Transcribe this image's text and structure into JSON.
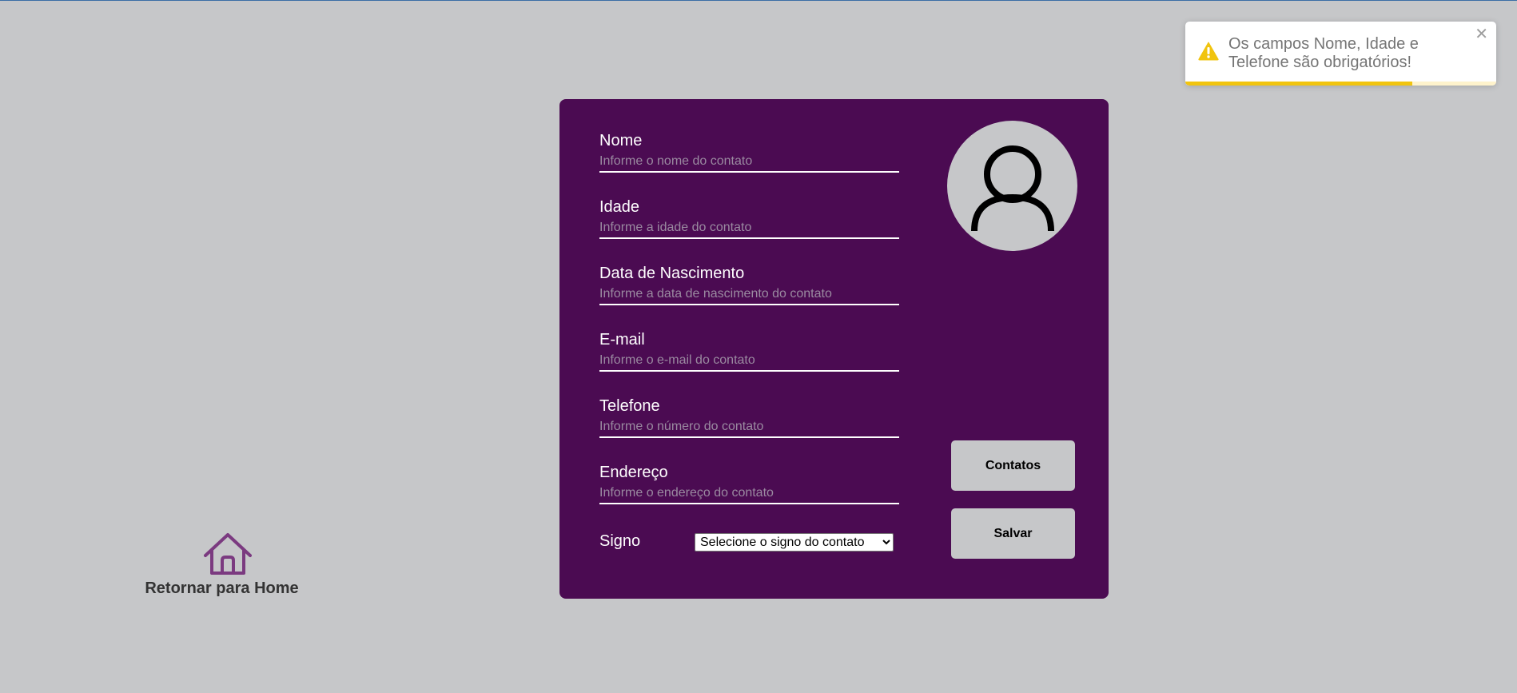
{
  "form": {
    "fields": [
      {
        "label": "Nome",
        "placeholder": "Informe o nome do contato",
        "value": ""
      },
      {
        "label": "Idade",
        "placeholder": "Informe a idade do contato",
        "value": ""
      },
      {
        "label": "Data de Nascimento",
        "placeholder": "Informe a data de nascimento do contato",
        "value": ""
      },
      {
        "label": "E-mail",
        "placeholder": "Informe o e-mail do contato",
        "value": ""
      },
      {
        "label": "Telefone",
        "placeholder": "Informe o número do contato",
        "value": ""
      },
      {
        "label": "Endereço",
        "placeholder": "Informe o endereço do contato",
        "value": ""
      }
    ],
    "signo": {
      "label": "Signo",
      "selected": "Selecione o signo do contato"
    },
    "buttons": {
      "contatos": "Contatos",
      "salvar": "Salvar"
    },
    "avatar_icon": "user-avatar-icon"
  },
  "home": {
    "label": "Retornar para Home",
    "icon": "house-icon"
  },
  "toast": {
    "message": "Os campos Nome, Idade e Telefone são obrigatórios!",
    "icon": "warning-icon",
    "close_icon": "close-icon",
    "progress": 0.73
  },
  "colors": {
    "background": "#c6c7c9",
    "card": "#4b0b52",
    "accent_purple": "#7b3a80",
    "warning": "#f1c40f"
  }
}
